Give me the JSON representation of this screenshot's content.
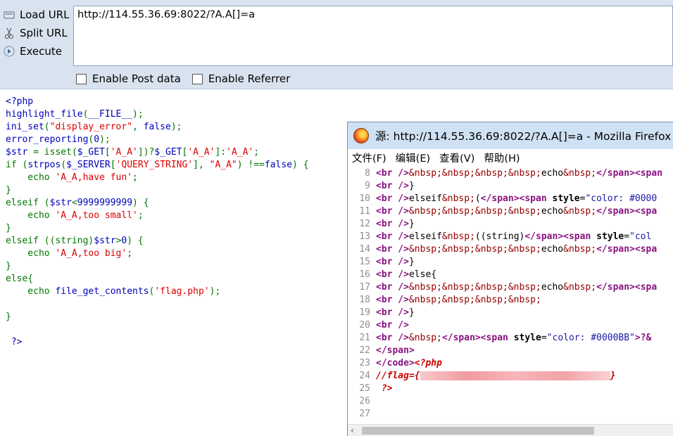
{
  "hackbar": {
    "actions": [
      {
        "label": "Load URL",
        "icon": "load-url-icon"
      },
      {
        "label": "Split URL",
        "icon": "split-url-icon"
      },
      {
        "label": "Execute",
        "icon": "execute-icon"
      }
    ],
    "url_value": "http://114.55.36.69:8022/?A.A[]=a",
    "checkboxes": [
      {
        "label": "Enable Post data",
        "checked": false
      },
      {
        "label": "Enable Referrer",
        "checked": false
      }
    ]
  },
  "source": {
    "lines": [
      [
        {
          "t": "<?php",
          "c": "blue"
        }
      ],
      [
        {
          "t": "highlight_file",
          "c": "blue"
        },
        {
          "t": "(",
          "c": "green"
        },
        {
          "t": "__FILE__",
          "c": "blue"
        },
        {
          "t": ");",
          "c": "green"
        }
      ],
      [
        {
          "t": "ini_set",
          "c": "blue"
        },
        {
          "t": "(",
          "c": "green"
        },
        {
          "t": "\"display_error\"",
          "c": "red"
        },
        {
          "t": ", ",
          "c": "green"
        },
        {
          "t": "false",
          "c": "blue"
        },
        {
          "t": ");",
          "c": "green"
        }
      ],
      [
        {
          "t": "error_reporting",
          "c": "blue"
        },
        {
          "t": "(",
          "c": "green"
        },
        {
          "t": "0",
          "c": "blue"
        },
        {
          "t": ");",
          "c": "green"
        }
      ],
      [
        {
          "t": "$str ",
          "c": "blue"
        },
        {
          "t": "= ",
          "c": "green"
        },
        {
          "t": "isset",
          "c": "green"
        },
        {
          "t": "(",
          "c": "green"
        },
        {
          "t": "$_GET",
          "c": "blue"
        },
        {
          "t": "[",
          "c": "green"
        },
        {
          "t": "'A_A'",
          "c": "red"
        },
        {
          "t": "])?",
          "c": "green"
        },
        {
          "t": "$_GET",
          "c": "blue"
        },
        {
          "t": "[",
          "c": "green"
        },
        {
          "t": "'A_A'",
          "c": "red"
        },
        {
          "t": "]:",
          "c": "green"
        },
        {
          "t": "'A_A'",
          "c": "red"
        },
        {
          "t": ";",
          "c": "green"
        }
      ],
      [
        {
          "t": "if ",
          "c": "green"
        },
        {
          "t": "(",
          "c": "green"
        },
        {
          "t": "strpos",
          "c": "blue"
        },
        {
          "t": "(",
          "c": "green"
        },
        {
          "t": "$_SERVER",
          "c": "blue"
        },
        {
          "t": "[",
          "c": "green"
        },
        {
          "t": "'QUERY_STRING'",
          "c": "red"
        },
        {
          "t": "], ",
          "c": "green"
        },
        {
          "t": "\"A_A\"",
          "c": "red"
        },
        {
          "t": ") !==",
          "c": "green"
        },
        {
          "t": "false",
          "c": "blue"
        },
        {
          "t": ") {",
          "c": "green"
        }
      ],
      [
        {
          "t": "    echo ",
          "c": "green"
        },
        {
          "t": "'A_A,have fun'",
          "c": "red"
        },
        {
          "t": ";",
          "c": "green"
        }
      ],
      [
        {
          "t": "}",
          "c": "green"
        }
      ],
      [
        {
          "t": "elseif ",
          "c": "green"
        },
        {
          "t": "(",
          "c": "green"
        },
        {
          "t": "$str",
          "c": "blue"
        },
        {
          "t": "<",
          "c": "green"
        },
        {
          "t": "9999999999",
          "c": "blue"
        },
        {
          "t": ") {",
          "c": "green"
        }
      ],
      [
        {
          "t": "    echo ",
          "c": "green"
        },
        {
          "t": "'A_A,too small'",
          "c": "red"
        },
        {
          "t": ";",
          "c": "green"
        }
      ],
      [
        {
          "t": "}",
          "c": "green"
        }
      ],
      [
        {
          "t": "elseif ",
          "c": "green"
        },
        {
          "t": "((string)",
          "c": "green"
        },
        {
          "t": "$str",
          "c": "blue"
        },
        {
          "t": ">",
          "c": "green"
        },
        {
          "t": "0",
          "c": "blue"
        },
        {
          "t": ") {",
          "c": "green"
        }
      ],
      [
        {
          "t": "    echo ",
          "c": "green"
        },
        {
          "t": "'A_A,too big'",
          "c": "red"
        },
        {
          "t": ";",
          "c": "green"
        }
      ],
      [
        {
          "t": "}",
          "c": "green"
        }
      ],
      [
        {
          "t": "else{",
          "c": "green"
        }
      ],
      [
        {
          "t": "    echo ",
          "c": "green"
        },
        {
          "t": "file_get_contents",
          "c": "blue"
        },
        {
          "t": "(",
          "c": "green"
        },
        {
          "t": "'flag.php'",
          "c": "red"
        },
        {
          "t": ");",
          "c": "green"
        }
      ],
      [],
      [
        {
          "t": "}",
          "c": "green"
        }
      ],
      [],
      [
        {
          "t": " ?>",
          "c": "blue"
        }
      ]
    ]
  },
  "view_source": {
    "title": "源: http://114.55.36.69:8022/?A.A[]=a - Mozilla Firefox",
    "menu": [
      "文件(F)",
      "编辑(E)",
      "查看(V)",
      "帮助(H)"
    ],
    "lines": [
      {
        "n": "8",
        "s": [
          {
            "t": "<br />",
            "c": "tag"
          },
          {
            "t": "&nbsp;&nbsp;&nbsp;&nbsp;",
            "c": "ent"
          },
          {
            "t": "echo",
            "c": "txt"
          },
          {
            "t": "&nbsp;",
            "c": "ent"
          },
          {
            "t": "</span>",
            "c": "tag"
          },
          {
            "t": "<span",
            "c": "tag"
          }
        ]
      },
      {
        "n": "9",
        "s": [
          {
            "t": "<br />",
            "c": "tag"
          },
          {
            "t": "}",
            "c": "txt"
          }
        ]
      },
      {
        "n": "10",
        "s": [
          {
            "t": "<br />",
            "c": "tag"
          },
          {
            "t": "elseif",
            "c": "txt"
          },
          {
            "t": "&nbsp;",
            "c": "ent"
          },
          {
            "t": "(",
            "c": "txt"
          },
          {
            "t": "</span>",
            "c": "tag"
          },
          {
            "t": "<span ",
            "c": "tag"
          },
          {
            "t": "style",
            "c": "attr"
          },
          {
            "t": "=",
            "c": "txt"
          },
          {
            "t": "\"color: #0000",
            "c": "aval"
          }
        ]
      },
      {
        "n": "11",
        "s": [
          {
            "t": "<br />",
            "c": "tag"
          },
          {
            "t": "&nbsp;&nbsp;&nbsp;&nbsp;",
            "c": "ent"
          },
          {
            "t": "echo",
            "c": "txt"
          },
          {
            "t": "&nbsp;",
            "c": "ent"
          },
          {
            "t": "</span>",
            "c": "tag"
          },
          {
            "t": "<spa",
            "c": "tag"
          }
        ]
      },
      {
        "n": "12",
        "s": [
          {
            "t": "<br />",
            "c": "tag"
          },
          {
            "t": "}",
            "c": "txt"
          }
        ]
      },
      {
        "n": "13",
        "s": [
          {
            "t": "<br />",
            "c": "tag"
          },
          {
            "t": "elseif",
            "c": "txt"
          },
          {
            "t": "&nbsp;",
            "c": "ent"
          },
          {
            "t": "((string)",
            "c": "txt"
          },
          {
            "t": "</span>",
            "c": "tag"
          },
          {
            "t": "<span ",
            "c": "tag"
          },
          {
            "t": "style",
            "c": "attr"
          },
          {
            "t": "=",
            "c": "txt"
          },
          {
            "t": "\"col",
            "c": "aval"
          }
        ]
      },
      {
        "n": "14",
        "s": [
          {
            "t": "<br />",
            "c": "tag"
          },
          {
            "t": "&nbsp;&nbsp;&nbsp;&nbsp;",
            "c": "ent"
          },
          {
            "t": "echo",
            "c": "txt"
          },
          {
            "t": "&nbsp;",
            "c": "ent"
          },
          {
            "t": "</span>",
            "c": "tag"
          },
          {
            "t": "<spa",
            "c": "tag"
          }
        ]
      },
      {
        "n": "15",
        "s": [
          {
            "t": "<br />",
            "c": "tag"
          },
          {
            "t": "}",
            "c": "txt"
          }
        ]
      },
      {
        "n": "16",
        "s": [
          {
            "t": "<br />",
            "c": "tag"
          },
          {
            "t": "else{",
            "c": "txt"
          }
        ]
      },
      {
        "n": "17",
        "s": [
          {
            "t": "<br />",
            "c": "tag"
          },
          {
            "t": "&nbsp;&nbsp;&nbsp;&nbsp;",
            "c": "ent"
          },
          {
            "t": "echo",
            "c": "txt"
          },
          {
            "t": "&nbsp;",
            "c": "ent"
          },
          {
            "t": "</span>",
            "c": "tag"
          },
          {
            "t": "<spa",
            "c": "tag"
          }
        ]
      },
      {
        "n": "18",
        "s": [
          {
            "t": "<br />",
            "c": "tag"
          },
          {
            "t": "&nbsp;&nbsp;&nbsp;&nbsp;",
            "c": "ent"
          }
        ]
      },
      {
        "n": "19",
        "s": [
          {
            "t": "<br />",
            "c": "tag"
          },
          {
            "t": "}",
            "c": "txt"
          }
        ]
      },
      {
        "n": "20",
        "s": [
          {
            "t": "<br />",
            "c": "tag"
          }
        ]
      },
      {
        "n": "21",
        "s": [
          {
            "t": "<br />",
            "c": "tag"
          },
          {
            "t": "&nbsp;",
            "c": "ent"
          },
          {
            "t": "</span>",
            "c": "tag"
          },
          {
            "t": "<span ",
            "c": "tag"
          },
          {
            "t": "style",
            "c": "attr"
          },
          {
            "t": "=",
            "c": "txt"
          },
          {
            "t": "\"color: #0000BB\"",
            "c": "aval"
          },
          {
            "t": ">?&",
            "c": "tag"
          }
        ]
      },
      {
        "n": "22",
        "s": [
          {
            "t": "</span>",
            "c": "tag"
          }
        ]
      },
      {
        "n": "23",
        "s": [
          {
            "t": "</code>",
            "c": "tag"
          },
          {
            "t": "<?php",
            "c": "php"
          }
        ]
      },
      {
        "n": "24",
        "s": [
          {
            "t": "//flag={",
            "c": "php"
          },
          {
            "t": "",
            "c": "blur"
          },
          {
            "t": "}",
            "c": "php"
          }
        ]
      },
      {
        "n": "25",
        "s": [
          {
            "t": " ?>",
            "c": "php"
          }
        ]
      },
      {
        "n": "26",
        "s": []
      },
      {
        "n": "27",
        "s": []
      }
    ]
  }
}
